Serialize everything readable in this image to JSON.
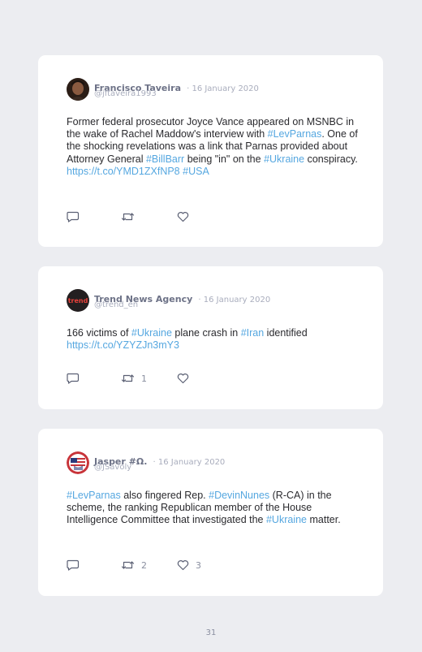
{
  "tweets": [
    {
      "name": "Francisco Taveira",
      "date": "· 16 January 2020",
      "handle": "@jftaveira1993",
      "segments": [
        {
          "text": "Former federal prosecutor Joyce Vance appeared on MSNBC in the wake of Rachel Maddow's interview with ",
          "link": false
        },
        {
          "text": "#LevParnas",
          "link": true
        },
        {
          "text": ". One of the shocking revelations was a link that Parnas provided about Attorney General ",
          "link": false
        },
        {
          "text": "#BillBarr",
          "link": true
        },
        {
          "text": " being \"in\" on the ",
          "link": false
        },
        {
          "text": "#Ukraine",
          "link": true
        },
        {
          "text": " conspiracy. ",
          "link": false
        },
        {
          "text": "https://t.co/YMD1ZXfNP8",
          "link": true
        },
        {
          "text": " ",
          "link": false
        },
        {
          "text": "#USA",
          "link": true
        }
      ],
      "retweets": "",
      "likes": ""
    },
    {
      "name": "Trend News Agency",
      "date": "· 16 January 2020",
      "handle": "@trend_en",
      "avatar_text": "trend",
      "segments": [
        {
          "text": "166 victims of ",
          "link": false
        },
        {
          "text": "#Ukraine",
          "link": true
        },
        {
          "text": " plane crash in ",
          "link": false
        },
        {
          "text": "#Iran",
          "link": true
        },
        {
          "text": " identified ",
          "link": false
        },
        {
          "text": "https://t.co/YZYZJn3mY3",
          "link": true
        }
      ],
      "retweets": "1",
      "likes": ""
    },
    {
      "name": "Jasper #Ω.",
      "date": "· 16 January 2020",
      "handle": "@JSavoly",
      "segments": [
        {
          "text": "#LevParnas",
          "link": true
        },
        {
          "text": " also fingered Rep. ",
          "link": false
        },
        {
          "text": "#DevinNunes",
          "link": true
        },
        {
          "text": " (R-CA) in the scheme, the ranking Republican member of the House Intelligence Committee that investigated the ",
          "link": false
        },
        {
          "text": "#Ukraine",
          "link": true
        },
        {
          "text": " matter.",
          "link": false
        }
      ],
      "retweets": "2",
      "likes": "3"
    }
  ],
  "page_number": "31",
  "colors": {
    "background": "#ecedf1",
    "card": "#ffffff",
    "link": "#55a7e0",
    "name": "#6d7287",
    "meta": "#a9adbd"
  },
  "icons": [
    "reply-icon",
    "retweet-icon",
    "like-icon"
  ]
}
